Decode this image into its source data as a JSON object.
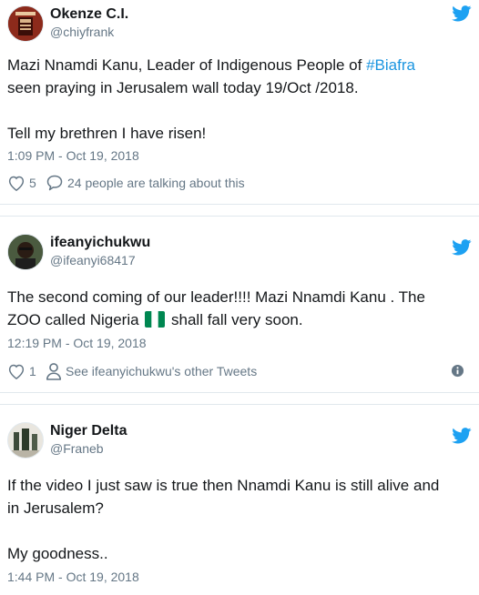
{
  "tweets": [
    {
      "display_name": "Okenze C.I.",
      "handle": "@chiyfrank",
      "text_part1": "Mazi Nnamdi Kanu, Leader of Indigenous People of ",
      "hashtag": "#Biafra",
      "text_part2": "\nseen praying in Jerusalem wall today 19/Oct /2018.\n\nTell my brethren I have risen!",
      "timestamp": "1:09 PM - Oct 19, 2018",
      "likes": "5",
      "conversation": "24 people are talking about this"
    },
    {
      "display_name": "ifeanyichukwu",
      "handle": "@ifeanyi68417",
      "text_part1": "The second coming of our leader!!!! Mazi Nnamdi Kanu . The\nZOO called Nigeria ",
      "text_part2": " shall fall very soon.",
      "timestamp": "12:19 PM - Oct 19, 2018",
      "likes": "1",
      "profile_link": "See ifeanyichukwu's other Tweets"
    },
    {
      "display_name": "Niger Delta",
      "handle": "@Franeb",
      "text": "If the video I just saw is true then Nnamdi Kanu is still alive and\nin Jerusalem?\n\nMy goodness..",
      "timestamp": "1:44 PM - Oct 19, 2018"
    }
  ],
  "colors": {
    "text": "#14171a",
    "muted": "#657786",
    "link": "#1b95e0",
    "twitter_blue": "#1da1f2",
    "border": "#e1e8ed",
    "nigeria_green": "#008751"
  },
  "icons": [
    "twitter-bird-icon",
    "heart-icon",
    "reply-bubble-icon",
    "person-icon",
    "info-icon",
    "nigeria-flag-icon"
  ]
}
